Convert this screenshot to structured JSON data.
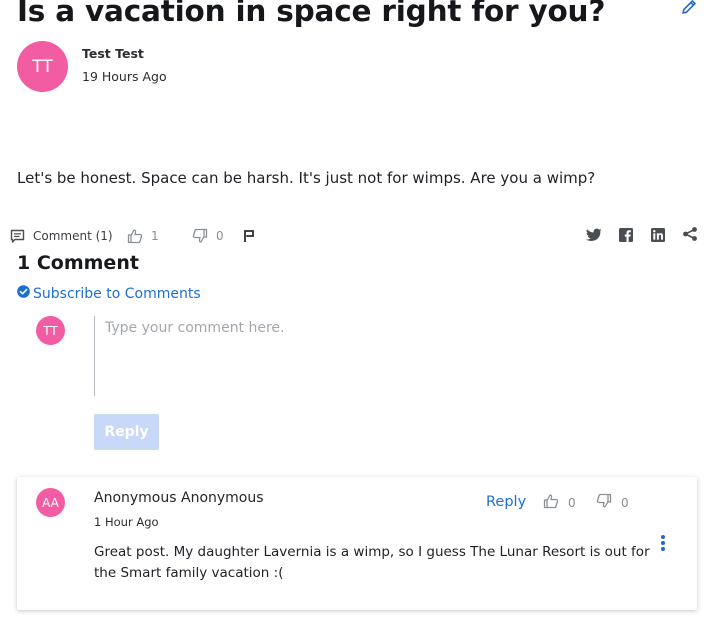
{
  "post": {
    "title": "Is a vacation in space right for you?",
    "author_initials": "TT",
    "author_name": "Test Test",
    "posted_time": "19 Hours Ago",
    "body": "Let's be honest. Space can be harsh. It's just not for wimps. Are you a wimp?"
  },
  "actions": {
    "comment_label": "Comment (1)",
    "likes": "1",
    "dislikes": "0"
  },
  "comments_section": {
    "heading": "1 Comment",
    "subscribe_label": "Subscribe to Comments",
    "composer_initials": "TT",
    "composer_placeholder": "Type your comment here.",
    "reply_button_label": "Reply"
  },
  "comments": [
    {
      "initials": "AA",
      "name": "Anonymous Anonymous",
      "time": "1 Hour Ago",
      "reply_label": "Reply",
      "likes": "0",
      "dislikes": "0",
      "text": "Great post. My daughter Lavernia is a wimp, so I guess The Lunar Resort is out for the Smart family vacation :("
    }
  ],
  "colors": {
    "avatar": "#f25ca2",
    "link": "#1f6fd1",
    "reply_button_disabled": "#c8d8f9"
  },
  "icons": [
    "edit-icon",
    "comment-icon",
    "thumbs-up-icon",
    "thumbs-down-icon",
    "flag-icon",
    "twitter-icon",
    "facebook-icon",
    "linkedin-icon",
    "share-icon",
    "check-circle-icon",
    "kebab-menu-icon"
  ]
}
